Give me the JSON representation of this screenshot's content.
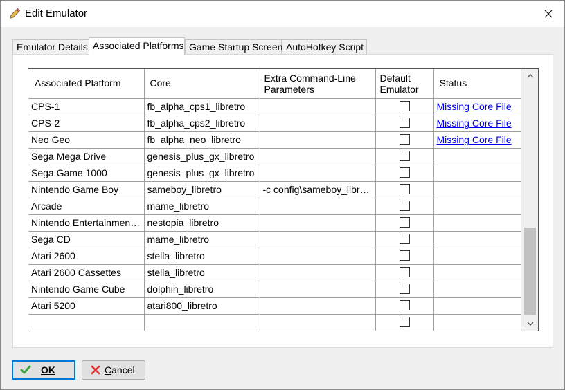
{
  "window": {
    "title": "Edit Emulator"
  },
  "tabs": [
    {
      "label": "Emulator Details"
    },
    {
      "label": "Associated Platforms"
    },
    {
      "label": "Game Startup Screen"
    },
    {
      "label": "AutoHotkey Script"
    }
  ],
  "grid": {
    "headers": {
      "platform": "Associated Platform",
      "core": "Core",
      "extra_line1": "Extra Command-Line",
      "extra_line2": "Parameters",
      "default_line1": "Default",
      "default_line2": "Emulator",
      "status": "Status"
    },
    "rows": [
      {
        "platform": "CPS-1",
        "core": "fb_alpha_cps1_libretro",
        "params": "",
        "status": "Missing Core File"
      },
      {
        "platform": "CPS-2",
        "core": "fb_alpha_cps2_libretro",
        "params": "",
        "status": "Missing Core File"
      },
      {
        "platform": "Neo Geo",
        "core": "fb_alpha_neo_libretro",
        "params": "",
        "status": "Missing Core File"
      },
      {
        "platform": "Sega Mega Drive",
        "core": "genesis_plus_gx_libretro",
        "params": "",
        "status": ""
      },
      {
        "platform": "Sega Game 1000",
        "core": "genesis_plus_gx_libretro",
        "params": "",
        "status": ""
      },
      {
        "platform": "Nintendo Game Boy",
        "core": "sameboy_libretro",
        "params": "-c config\\sameboy_libre...",
        "status": ""
      },
      {
        "platform": "Arcade",
        "core": "mame_libretro",
        "params": "",
        "status": ""
      },
      {
        "platform": "Nintendo Entertainment...",
        "core": "nestopia_libretro",
        "params": "",
        "status": ""
      },
      {
        "platform": "Sega CD",
        "core": "mame_libretro",
        "params": "",
        "status": ""
      },
      {
        "platform": "Atari 2600",
        "core": "stella_libretro",
        "params": "",
        "status": ""
      },
      {
        "platform": "Atari 2600 Cassettes",
        "core": "stella_libretro",
        "params": "",
        "status": ""
      },
      {
        "platform": "Nintendo Game Cube",
        "core": "dolphin_libretro",
        "params": "",
        "status": ""
      },
      {
        "platform": "Atari 5200",
        "core": "atari800_libretro",
        "params": "",
        "status": ""
      },
      {
        "platform": "",
        "core": "",
        "params": "",
        "status": ""
      }
    ]
  },
  "buttons": {
    "ok": "OK",
    "cancel_c": "C",
    "cancel_rest": "ancel"
  },
  "icons": {
    "title": "pencil-icon",
    "close": "close-icon",
    "ok": "checkmark-icon",
    "cancel": "x-icon"
  },
  "colors": {
    "link": "#0000ee",
    "ok_border": "#0078d7",
    "checkmark": "#3aa53a",
    "cancel_x": "#e03030"
  }
}
